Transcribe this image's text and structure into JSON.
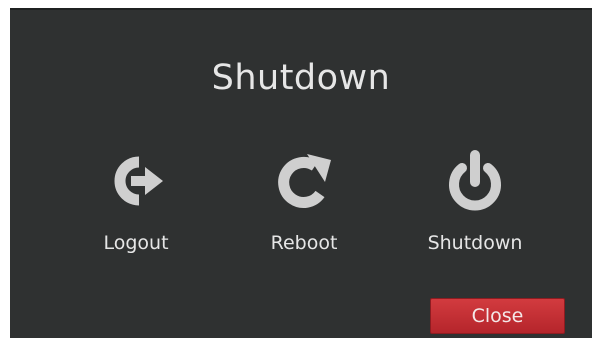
{
  "dialog": {
    "title": "Shutdown"
  },
  "actions": [
    {
      "label": "Logout",
      "icon": "logout-icon"
    },
    {
      "label": "Reboot",
      "icon": "reboot-icon"
    },
    {
      "label": "Shutdown",
      "icon": "power-icon"
    }
  ],
  "close_label": "Close",
  "colors": {
    "background": "#2f3131",
    "text": "#e6e6e6",
    "icon": "#cfcfcf",
    "close_button": "#c8323a"
  }
}
